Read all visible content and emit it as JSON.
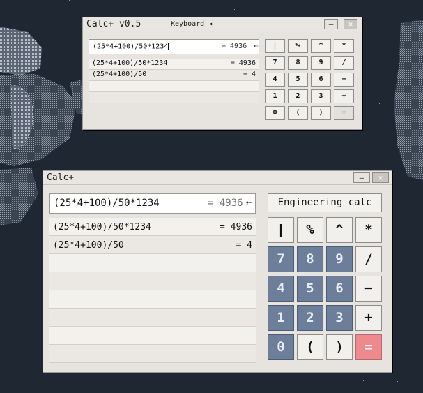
{
  "small_window": {
    "title": "Calc+ v0.5",
    "keyboard_label": "Keyboard",
    "keyboard_arrow": "◂",
    "minimize": "—",
    "close": "✕",
    "input_expr": "(25*4+100)/50*1234",
    "input_result": "= 4936",
    "backspace": "⇠",
    "history": [
      {
        "expr": "(25*4+100)/50*1234",
        "result": "= 4936"
      },
      {
        "expr": "(25*4+100)/50",
        "result": "= 4"
      }
    ],
    "keys": [
      "|",
      "%",
      "^",
      "*",
      "7",
      "8",
      "9",
      "/",
      "4",
      "5",
      "6",
      "−",
      "1",
      "2",
      "3",
      "+",
      "0",
      "(",
      ")",
      "="
    ]
  },
  "main_window": {
    "title": "Calc+",
    "minimize": "—",
    "close": "✕",
    "input_expr": "(25*4+100)/50*1234",
    "input_result": "= 4936",
    "backspace": "⇠",
    "engineering_label": "Engineering calc",
    "history": [
      {
        "expr": "(25*4+100)/50*1234",
        "result": "= 4936"
      },
      {
        "expr": "(25*4+100)/50",
        "result": "= 4"
      }
    ],
    "keys": [
      "|",
      "%",
      "^",
      "*",
      "7",
      "8",
      "9",
      "/",
      "4",
      "5",
      "6",
      "−",
      "1",
      "2",
      "3",
      "+",
      "0",
      "(",
      ")",
      "="
    ]
  },
  "colors": {
    "number_key": "#6d7e9b",
    "equals_key": "#ee8a8e",
    "background": "#1e2732"
  }
}
